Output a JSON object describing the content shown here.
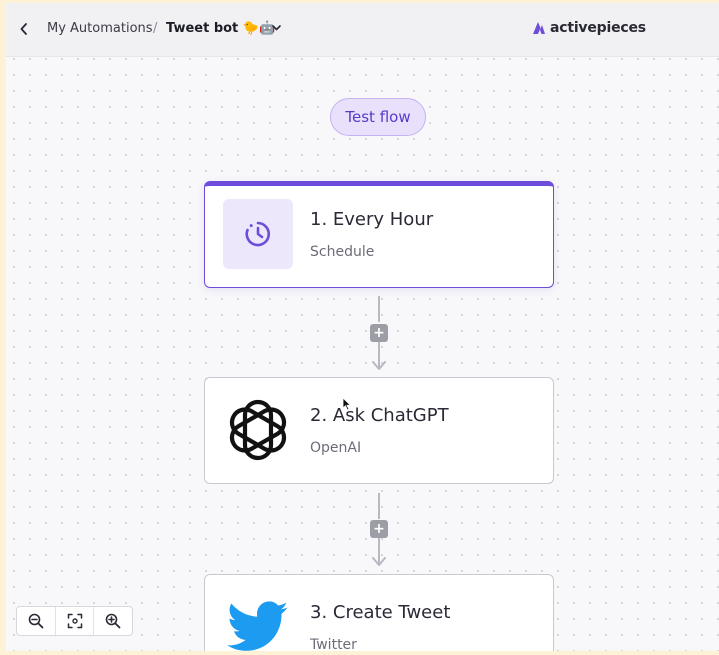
{
  "header": {
    "breadcrumb_home": "My Automations",
    "breadcrumb_separator": "/",
    "flow_name": "Tweet bot 🐤🤖",
    "brand_name": "activepieces",
    "back_icon": "chevron-left-icon",
    "menu_icon": "chevron-down-icon"
  },
  "canvas": {
    "test_flow_label": "Test flow",
    "steps": [
      {
        "title": "1. Every Hour",
        "subtitle": "Schedule",
        "icon": "schedule-timer-icon"
      },
      {
        "title": "2. Ask ChatGPT",
        "subtitle": "OpenAI",
        "icon": "openai-logo-icon"
      },
      {
        "title": "3. Create Tweet",
        "subtitle": "Twitter",
        "icon": "twitter-bird-icon"
      }
    ],
    "add_step_label": "+"
  },
  "zoom_controls": {
    "zoom_out_icon": "zoom-out-icon",
    "fit_icon": "fit-view-icon",
    "zoom_in_icon": "zoom-in-icon"
  },
  "colors": {
    "accent": "#6e4ddb",
    "accent_light": "#ece7fb",
    "twitter_blue": "#1d9bf0"
  }
}
